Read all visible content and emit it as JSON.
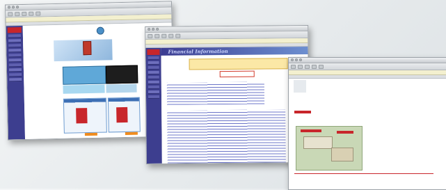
{
  "window1": {
    "title": "",
    "logo": "",
    "address": "",
    "page_title": "",
    "panels": [],
    "products": []
  },
  "window2": {
    "title": "",
    "logo": "",
    "address": "",
    "header": "Financial Information",
    "nav_links": [],
    "sections": []
  },
  "window3": {
    "title": "",
    "logo": "",
    "address": "",
    "heading": "",
    "caption": ""
  }
}
